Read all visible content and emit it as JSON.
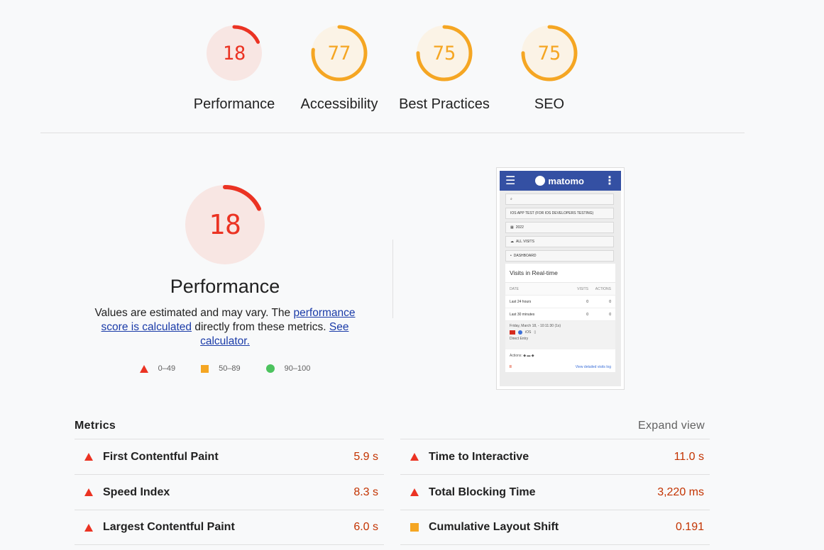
{
  "colors": {
    "fail": "#eb3323",
    "average": "#f5a623",
    "pass": "#4cc35e",
    "fail_bg": "#f8e6e3",
    "average_bg": "#fbf3e6"
  },
  "gauges": [
    {
      "label": "Performance",
      "score": "18",
      "value": 18,
      "rating": "fail"
    },
    {
      "label": "Accessibility",
      "score": "77",
      "value": 77,
      "rating": "average"
    },
    {
      "label": "Best Practices",
      "score": "75",
      "value": 75,
      "rating": "average"
    },
    {
      "label": "SEO",
      "score": "75",
      "value": 75,
      "rating": "average"
    }
  ],
  "performance": {
    "score": "18",
    "value": 18,
    "title": "Performance",
    "desc_prefix": "Values are estimated and may vary. The ",
    "desc_link1": "performance score is calculated",
    "desc_middle": " directly from these metrics. ",
    "desc_link2": "See calculator.",
    "legend": [
      {
        "icon": "triangle",
        "range": "0–49"
      },
      {
        "icon": "square",
        "range": "50–89"
      },
      {
        "icon": "circle",
        "range": "90–100"
      }
    ]
  },
  "screenshot": {
    "logo": "matomo",
    "fields": [
      "IOS APP TEST (FOR IOS DEVELOPERS TESTING)",
      "2022",
      "ALL VISITS",
      "DASHBOARD"
    ],
    "card_title": "Visits in Real-time",
    "table_head": [
      "DATE",
      "VISITS",
      "ACTIONS"
    ],
    "rows": [
      [
        "Last 24 hours",
        "0",
        "0"
      ],
      [
        "Last 30 minutes",
        "0",
        "0"
      ]
    ],
    "visit_date": "Friday, March 18, - 10:11:30 (1s)",
    "visit_os": "iOS",
    "visit_entry": "Direct Entry",
    "actions_label": "Actions:",
    "pause": "II",
    "log_link": "View detailed visits log"
  },
  "metrics": {
    "title": "Metrics",
    "expand_label": "Expand view",
    "left": [
      {
        "name": "First Contentful Paint",
        "value": "5.9 s",
        "rating": "fail"
      },
      {
        "name": "Speed Index",
        "value": "8.3 s",
        "rating": "fail"
      },
      {
        "name": "Largest Contentful Paint",
        "value": "6.0 s",
        "rating": "fail"
      }
    ],
    "right": [
      {
        "name": "Time to Interactive",
        "value": "11.0 s",
        "rating": "fail"
      },
      {
        "name": "Total Blocking Time",
        "value": "3,220 ms",
        "rating": "fail"
      },
      {
        "name": "Cumulative Layout Shift",
        "value": "0.191",
        "rating": "average"
      }
    ]
  }
}
